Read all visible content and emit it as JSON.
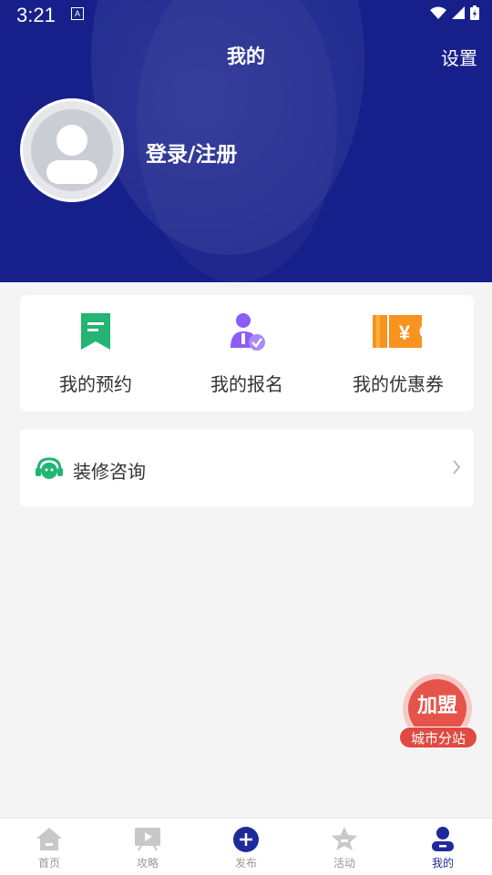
{
  "status": {
    "time": "3:21",
    "notif_letter": "A"
  },
  "header": {
    "title": "我的",
    "settings_label": "设置",
    "login_label": "登录/注册"
  },
  "quick_actions": [
    {
      "label": "我的预约",
      "icon": "bookmark-icon",
      "color": "#22b573"
    },
    {
      "label": "我的报名",
      "icon": "user-check-icon",
      "color": "#8b5cf6"
    },
    {
      "label": "我的优惠券",
      "icon": "coupon-icon",
      "color": "#f59e0b"
    }
  ],
  "menu": {
    "consult_label": "装修咨询",
    "icon": "headset-icon"
  },
  "join": {
    "main_label": "加盟",
    "sub_label": "城市分站"
  },
  "tabbar": [
    {
      "label": "首页",
      "icon": "home-icon",
      "active": false
    },
    {
      "label": "攻略",
      "icon": "video-icon",
      "active": false
    },
    {
      "label": "发布",
      "icon": "plus-icon",
      "active": false
    },
    {
      "label": "活动",
      "icon": "star-icon",
      "active": false
    },
    {
      "label": "我的",
      "icon": "user-icon",
      "active": true
    }
  ],
  "colors": {
    "header_bg": "#17208a",
    "accent": "#1f2a9a",
    "join_red": "#e5544a"
  }
}
